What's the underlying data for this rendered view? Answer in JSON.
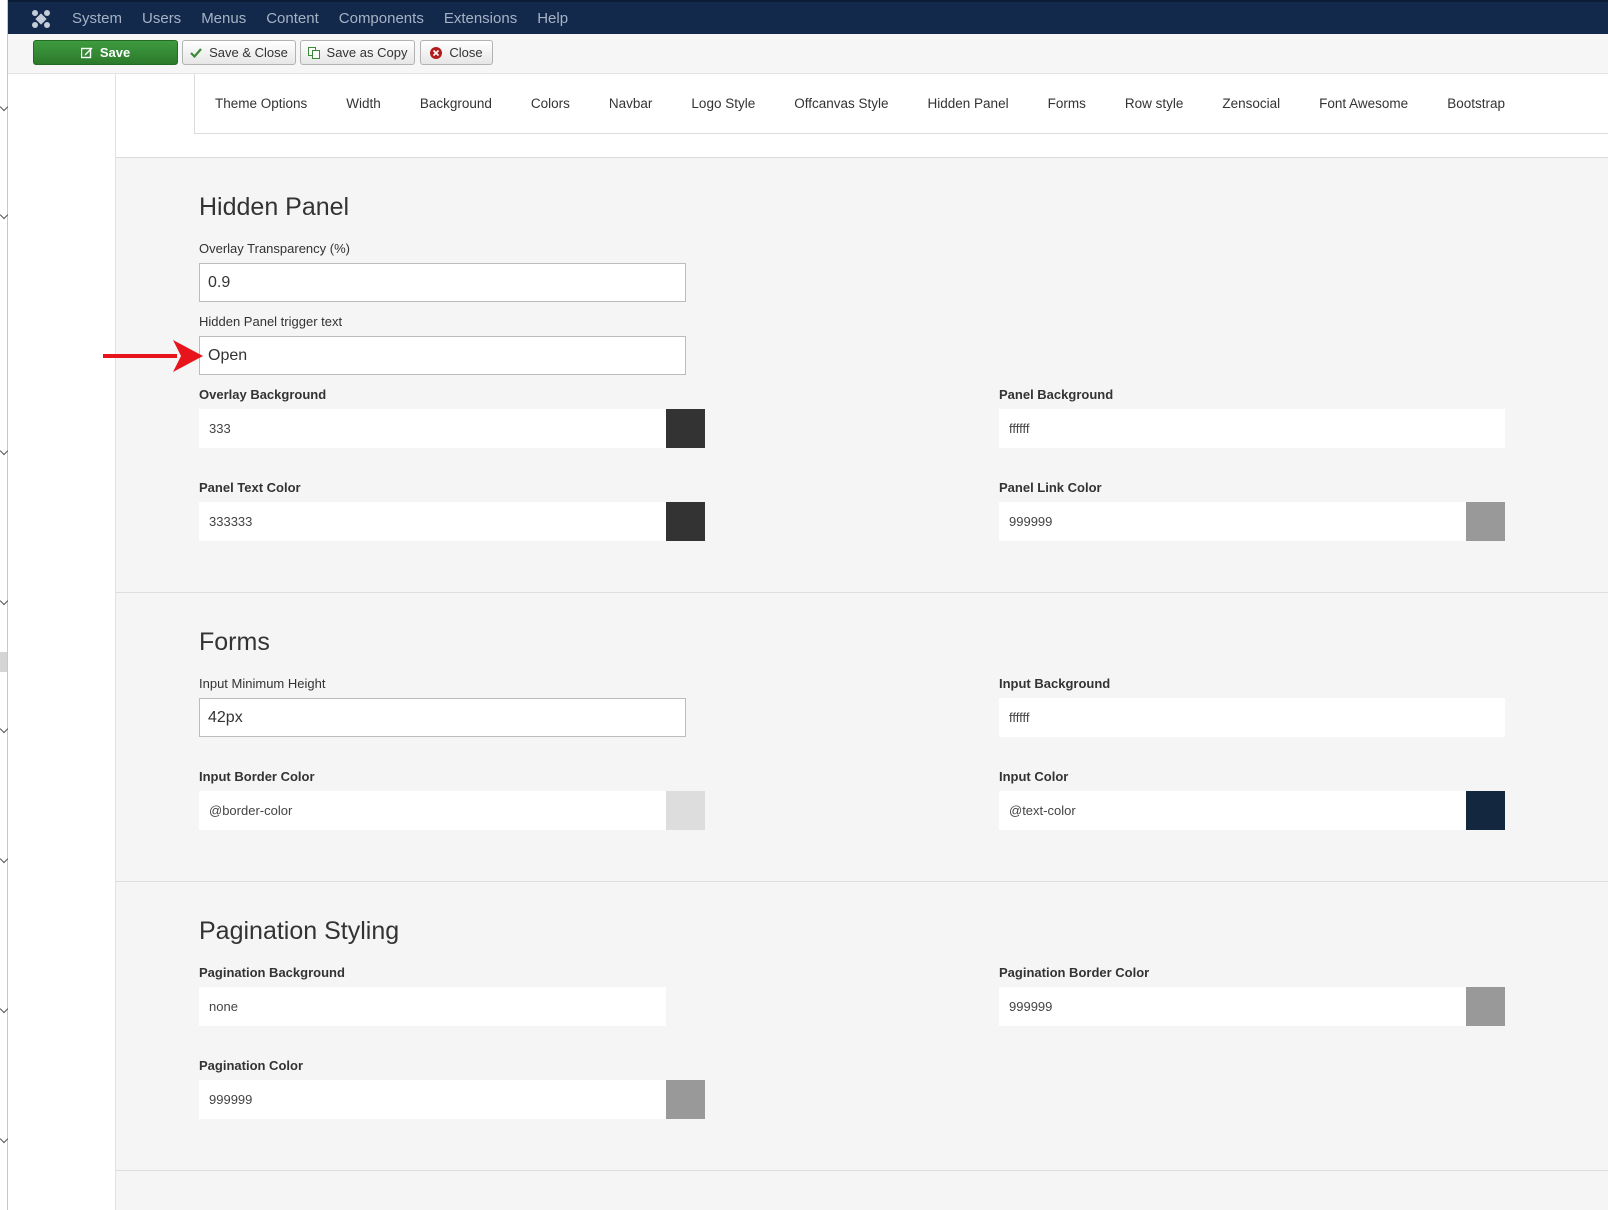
{
  "navbar": {
    "menu": [
      "System",
      "Users",
      "Menus",
      "Content",
      "Components",
      "Extensions",
      "Help"
    ]
  },
  "toolbar": {
    "save": "Save",
    "save_close": "Save & Close",
    "save_copy": "Save as Copy",
    "close": "Close"
  },
  "tabs": [
    "Theme Options",
    "Width",
    "Background",
    "Colors",
    "Navbar",
    "Logo Style",
    "Offcanvas Style",
    "Hidden Panel",
    "Forms",
    "Row style",
    "Zensocial",
    "Font Awesome",
    "Bootstrap"
  ],
  "hidden_panel": {
    "title": "Hidden Panel",
    "overlay_transparency": {
      "label": "Overlay Transparency (%)",
      "value": "0.9"
    },
    "trigger_text": {
      "label": "Hidden Panel trigger text",
      "value": "Open"
    },
    "overlay_background": {
      "label": "Overlay Background",
      "value": "333",
      "swatch": "#333333"
    },
    "panel_background": {
      "label": "Panel Background",
      "value": "ffffff",
      "swatch": "#ffffff"
    },
    "panel_text_color": {
      "label": "Panel Text Color",
      "value": "333333",
      "swatch": "#333333"
    },
    "panel_link_color": {
      "label": "Panel Link Color",
      "value": "999999",
      "swatch": "#999999"
    }
  },
  "forms": {
    "title": "Forms",
    "input_min_height": {
      "label": "Input Minimum Height",
      "value": "42px"
    },
    "input_background": {
      "label": "Input Background",
      "value": "ffffff",
      "swatch": "#ffffff"
    },
    "input_border_color": {
      "label": "Input Border Color",
      "value": "@border-color",
      "swatch": "#dddddd"
    },
    "input_color": {
      "label": "Input Color",
      "value": "@text-color",
      "swatch": "#13273f"
    }
  },
  "pagination": {
    "title": "Pagination Styling",
    "background": {
      "label": "Pagination Background",
      "value": "none",
      "swatch": "#f5f5f5"
    },
    "border_color": {
      "label": "Pagination Border Color",
      "value": "999999",
      "swatch": "#999999"
    },
    "color": {
      "label": "Pagination Color",
      "value": "999999",
      "swatch": "#999999"
    }
  },
  "colors": {
    "navbar_bg": "#13294b",
    "save_green": "#2c7a2c",
    "annotation_arrow": "#e8141c"
  }
}
